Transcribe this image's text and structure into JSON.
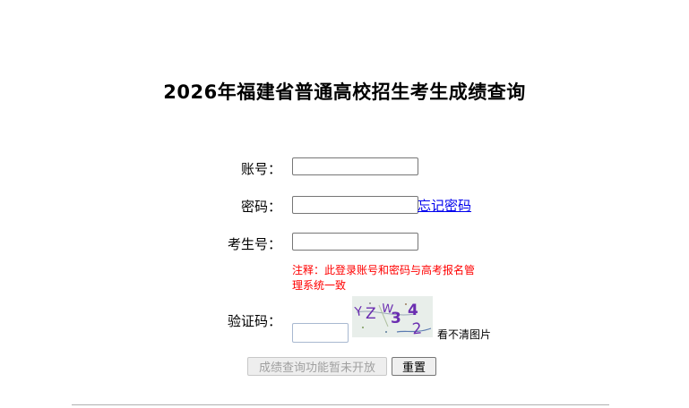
{
  "page_title": "2026年福建省普通高校招生考生成绩查询",
  "form": {
    "account_label": "账号：",
    "account_value": "",
    "password_label": "密码：",
    "password_value": "",
    "forgot_password_link": "忘记密码",
    "exam_number_label": "考生号：",
    "exam_number_value": "",
    "note": "注释：此登录账号和密码与高考报名管理系统一致",
    "captcha_label": "验证码：",
    "captcha_value": "",
    "captcha_chars": [
      "Y",
      "Z",
      "W",
      "3",
      "4",
      "2"
    ],
    "captcha_refresh_text": "看不清图片",
    "query_button": "成绩查询功能暂未开放",
    "reset_button": "重置"
  },
  "colors": {
    "note_text": "#ff0000",
    "link": "#0000ee",
    "captcha_chars": "#6a2db0"
  }
}
